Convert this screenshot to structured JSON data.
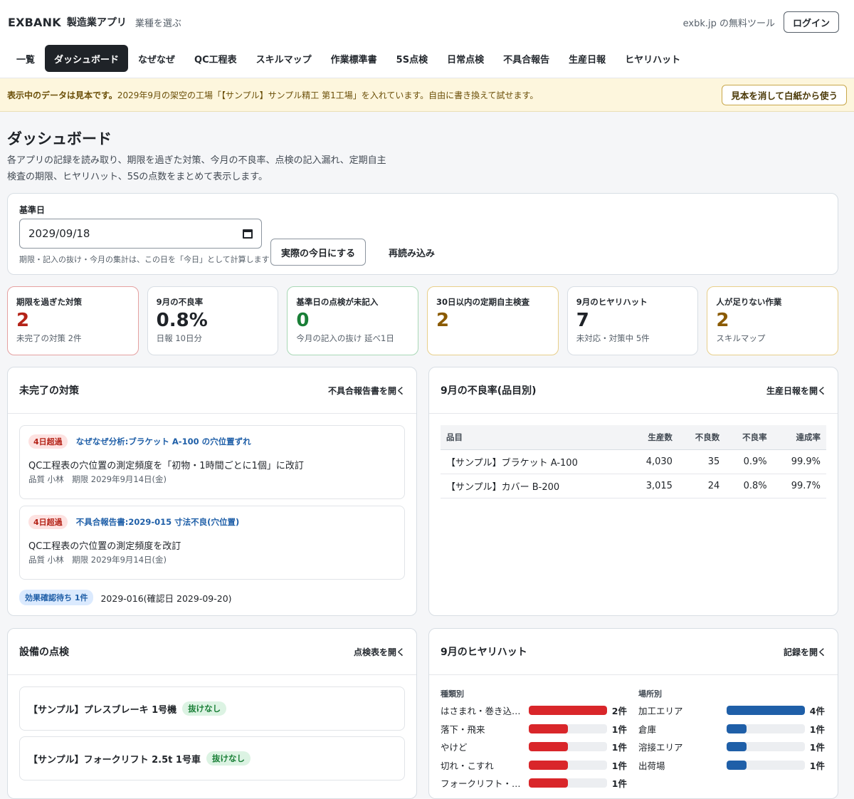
{
  "header": {
    "brand": "EXBANK",
    "app_name": "製造業アプリ",
    "choose_industry": "業種を選ぶ",
    "external": "exbk.jp の無料ツール",
    "login": "ログイン"
  },
  "tabs": [
    {
      "label": "一覧",
      "active": false
    },
    {
      "label": "ダッシュボード",
      "active": true
    },
    {
      "label": "なぜなぜ",
      "active": false
    },
    {
      "label": "QC工程表",
      "active": false
    },
    {
      "label": "スキルマップ",
      "active": false
    },
    {
      "label": "作業標準書",
      "active": false
    },
    {
      "label": "5S点検",
      "active": false
    },
    {
      "label": "日常点検",
      "active": false
    },
    {
      "label": "不具合報告",
      "active": false
    },
    {
      "label": "生産日報",
      "active": false
    },
    {
      "label": "ヒヤリハット",
      "active": false
    }
  ],
  "notice": {
    "bold": "表示中のデータは見本です。",
    "text": "2029年9月の架空の工場「【サンプル】サンプル精工 第1工場」を入れています。自由に書き換えて試せます。",
    "button": "見本を消して白紙から使う"
  },
  "page": {
    "title": "ダッシュボード",
    "description": "各アプリの記録を読み取り、期限を過ぎた対策、今月の不良率、点検の記入漏れ、定期自主検査の期限、ヒヤリハット、5Sの点数をまとめて表示します。"
  },
  "date_panel": {
    "label": "基準日",
    "value": "2029/09/18",
    "hint": "期限・記入の抜け・今月の集計は、この日を「今日」として計算します",
    "today_button": "実際の今日にする",
    "reload_button": "再読み込み"
  },
  "kpis": [
    {
      "title": "期限を過ぎた対策",
      "value": "2",
      "sub": "未完了の対策 2件",
      "tone": "red"
    },
    {
      "title": "9月の不良率",
      "value": "0.8%",
      "sub": "日報 10日分",
      "tone": "plain"
    },
    {
      "title": "基準日の点検が未記入",
      "value": "0",
      "sub": "今月の記入の抜け 延べ1日",
      "tone": "green"
    },
    {
      "title": "30日以内の定期自主検査",
      "value": "2",
      "sub": "",
      "tone": "amber"
    },
    {
      "title": "9月のヒヤリハット",
      "value": "7",
      "sub": "未対応・対策中 5件",
      "tone": "plain"
    },
    {
      "title": "人が足りない作業",
      "value": "2",
      "sub": "スキルマップ",
      "tone": "amber"
    }
  ],
  "open_actions": {
    "title": "未完了の対策",
    "link": "不具合報告書を開く",
    "items": [
      {
        "badge": "4日超過",
        "source": "なぜなぜ分析:ブラケット A-100 の穴位置ずれ",
        "text": "QC工程表の穴位置の測定頻度を「初物・1時間ごとに1個」に改訂",
        "meta": "品質 小林　期限 2029年9月14日(金)"
      },
      {
        "badge": "4日超過",
        "source": "不具合報告書:2029-015 寸法不良(穴位置)",
        "text": "QC工程表の穴位置の測定頻度を改訂",
        "meta": "品質 小林　期限 2029年9月14日(金)"
      }
    ],
    "waiting_badge": "効果確認待ち 1件",
    "waiting_text": "2029-016(確認日 2029-09-20)"
  },
  "defect_rate": {
    "title": "9月の不良率(品目別)",
    "link": "生産日報を開く",
    "columns": [
      "品目",
      "生産数",
      "不良数",
      "不良率",
      "達成率"
    ],
    "rows": [
      [
        "【サンプル】ブラケット A-100",
        "4,030",
        "35",
        "0.9%",
        "99.9%"
      ],
      [
        "【サンプル】カバー B-200",
        "3,015",
        "24",
        "0.8%",
        "99.7%"
      ]
    ]
  },
  "equipment": {
    "title": "設備の点検",
    "link": "点検表を開く",
    "items": [
      {
        "name": "【サンプル】プレスブレーキ 1号機",
        "status": "抜けなし"
      },
      {
        "name": "【サンプル】フォークリフト 2.5t 1号車",
        "status": "抜けなし"
      }
    ]
  },
  "hiyari": {
    "title": "9月のヒヤリハット",
    "link": "記録を開く",
    "by_type": {
      "label": "種類別",
      "items": [
        {
          "label": "はさまれ・巻き込まれ",
          "count": 2,
          "count_label": "2件"
        },
        {
          "label": "落下・飛来",
          "count": 1,
          "count_label": "1件"
        },
        {
          "label": "やけど",
          "count": 1,
          "count_label": "1件"
        },
        {
          "label": "切れ・こすれ",
          "count": 1,
          "count_label": "1件"
        },
        {
          "label": "フォークリフト・運搬",
          "count": 1,
          "count_label": "1件"
        }
      ]
    },
    "by_place": {
      "label": "場所別",
      "items": [
        {
          "label": "加工エリア",
          "count": 4,
          "count_label": "4件"
        },
        {
          "label": "倉庫",
          "count": 1,
          "count_label": "1件"
        },
        {
          "label": "溶接エリア",
          "count": 1,
          "count_label": "1件"
        },
        {
          "label": "出荷場",
          "count": 1,
          "count_label": "1件"
        }
      ]
    }
  },
  "colors": {
    "accent_dark": "#1f2328",
    "danger": "#b42318",
    "success": "#1a7f37",
    "warning": "#8a5a00",
    "link": "#1f5fa8",
    "bar_red": "#d9262a",
    "bar_blue": "#1f5fa8"
  }
}
